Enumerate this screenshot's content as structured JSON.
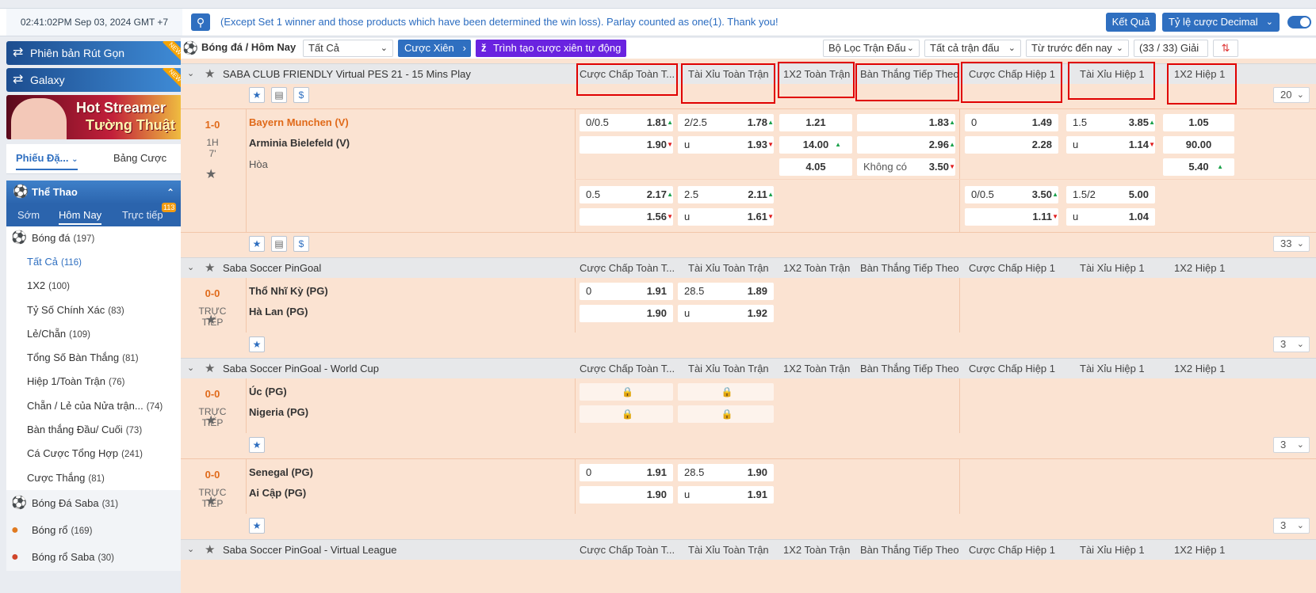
{
  "topbar": {
    "clock": "02:41:02PM Sep 03, 2024 GMT +7",
    "search_icon": "search-icon",
    "marquee": "(Except Set 1 winner and those products which have been determined the win loss). Parlay counted as one(1). Thank you!",
    "results_label": "Kết Quả",
    "odds_type_label": "Tỷ lệ cược Decimal"
  },
  "sidebar": {
    "promo1": "Phiên bản Rút Gọn",
    "promo2": "Galaxy",
    "new_badge": "NEW",
    "streamer_line1": "Hot Streamer",
    "streamer_line2": "Tường Thuật",
    "slip_tab": "Phiếu Đặ...",
    "table_tab": "Bảng Cược",
    "sport_header": "Thể Thao",
    "time_tabs": [
      "Sớm",
      "Hôm Nay",
      "Trực tiếp"
    ],
    "live_count": "113",
    "football": {
      "label": "Bóng đá",
      "count": "(197)"
    },
    "sub_items": [
      {
        "label": "Tất Cả",
        "count": "(116)"
      },
      {
        "label": "1X2",
        "count": "(100)"
      },
      {
        "label": "Tỷ Số Chính Xác",
        "count": "(83)"
      },
      {
        "label": "Lẻ/Chẵn",
        "count": "(109)"
      },
      {
        "label": "Tổng Số Bàn Thắng",
        "count": "(81)"
      },
      {
        "label": "Hiệp 1/Toàn Trận",
        "count": "(76)"
      },
      {
        "label": "Chẵn / Lẻ của Nửa trận...",
        "count": "(74)"
      },
      {
        "label": "Bàn thắng Đầu/ Cuối",
        "count": "(73)"
      },
      {
        "label": "Cá Cược Tổng Hợp",
        "count": "(241)"
      },
      {
        "label": "Cược Thắng",
        "count": "(81)"
      }
    ],
    "other_sports": [
      {
        "label": "Bóng Đá Saba",
        "count": "(31)"
      },
      {
        "label": "Bóng rổ",
        "count": "(169)"
      },
      {
        "label": "Bóng rổ Saba",
        "count": "(30)"
      }
    ]
  },
  "filter": {
    "crumb": "Bóng đá / Hôm Nay",
    "all": "Tất Cả",
    "parlay": "Cược Xiên",
    "auto_parlay": "Trình tạo cược xiên tự động",
    "match_filter": "Bộ Lọc Trận Đấu",
    "all_matches": "Tất cả trận đấu",
    "sort": "Từ trước đến nay",
    "leagues": "(33 / 33) Giải"
  },
  "columns": [
    "Cược Chấp Toàn T...",
    "Tài Xỉu Toàn Trận",
    "1X2 Toàn Trận",
    "Bàn Thắng Tiếp Theo",
    "Cược Chấp Hiệp 1",
    "Tài Xỉu Hiệp 1",
    "1X2 Hiệp 1"
  ],
  "leagues": [
    {
      "name": "SABA CLUB FRIENDLY Virtual PES 21 - 15 Mins Play",
      "more": "20"
    },
    {
      "name": "Saba Soccer PinGoal"
    },
    {
      "name": "Saba Soccer PinGoal - World Cup"
    },
    {
      "name": "Saba Soccer PinGoal - Virtual League"
    }
  ],
  "match1": {
    "score": "1-0",
    "period": "1H",
    "minute": "7'",
    "home": "Bayern Munchen (V)",
    "away": "Arminia Bielefeld (V)",
    "draw": "Hòa",
    "hdp": {
      "line": "0/0.5",
      "home": "1.81",
      "away": "1.90"
    },
    "ou": {
      "line": "2/2.5",
      "over": "1.78",
      "u": "u",
      "under": "1.93"
    },
    "x12": {
      "h": "1.21",
      "a": "14.00",
      "d": "4.05"
    },
    "ng": {
      "h": "1.83",
      "a": "2.96",
      "none_label": "Không có",
      "none": "3.50"
    },
    "hdp1": {
      "line": "0",
      "home": "1.49",
      "away": "2.28"
    },
    "ou1": {
      "line": "1.5",
      "over": "3.85",
      "u": "u",
      "under": "1.14"
    },
    "x121": {
      "h": "1.05",
      "a": "90.00",
      "d": "5.40"
    },
    "hdp_b": {
      "line": "0.5",
      "home": "2.17",
      "away": "1.56"
    },
    "ou_b": {
      "line": "2.5",
      "over": "2.11",
      "u": "u",
      "under": "1.61"
    },
    "hdp1_b": {
      "line": "0/0.5",
      "home": "3.50",
      "away": "1.11"
    },
    "ou1_b": {
      "line": "1.5/2",
      "over": "5.00",
      "u": "u",
      "under": "1.04"
    },
    "more": "33"
  },
  "match2": {
    "score": "0-0",
    "period": "TRỰC",
    "period2": "TIẾP",
    "home": "Thổ Nhĩ Kỳ (PG)",
    "away": "Hà Lan (PG)",
    "hdp": {
      "line": "0",
      "home": "1.91",
      "away": "1.90"
    },
    "ou": {
      "line": "28.5",
      "over": "1.89",
      "u": "u",
      "under": "1.92"
    },
    "more": "3"
  },
  "match3": {
    "score": "0-0",
    "period": "TRỰC",
    "period2": "TIẾP",
    "home": "Úc (PG)",
    "away": "Nigeria (PG)",
    "more": "3"
  },
  "match4": {
    "score": "0-0",
    "period": "TRỰC",
    "period2": "TIẾP",
    "home": "Senegal (PG)",
    "away": "Ai Cập (PG)",
    "hdp": {
      "line": "0",
      "home": "1.91",
      "away": "1.90"
    },
    "ou": {
      "line": "28.5",
      "over": "1.90",
      "u": "u",
      "under": "1.91"
    },
    "more": "3"
  },
  "colors": {
    "accent": "#2f6fc0",
    "favorite": "#e06a1a",
    "row_bg": "#fbe3d2",
    "highlight_box": "#e00000"
  }
}
